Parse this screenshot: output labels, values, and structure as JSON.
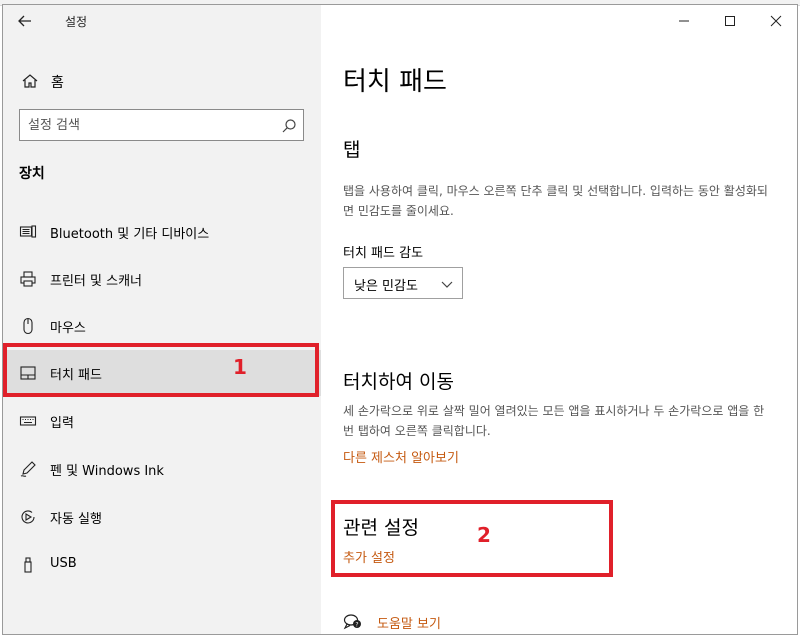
{
  "window": {
    "title": "설정",
    "back_icon": "back-arrow-icon",
    "controls": {
      "minimize_icon": "minimize-icon",
      "maximize_icon": "maximize-icon",
      "close_icon": "close-icon"
    }
  },
  "sidebar": {
    "home_label": "홈",
    "search_placeholder": "설정 검색",
    "section_title": "장치",
    "items": [
      {
        "label": "Bluetooth 및 기타 디바이스",
        "icon": "bluetooth-devices-icon"
      },
      {
        "label": "프린터 및 스캐너",
        "icon": "printer-icon"
      },
      {
        "label": "마우스",
        "icon": "mouse-icon"
      },
      {
        "label": "터치 패드",
        "icon": "touchpad-icon",
        "selected": true
      },
      {
        "label": "입력",
        "icon": "keyboard-icon"
      },
      {
        "label": "펜 및 Windows Ink",
        "icon": "pen-icon"
      },
      {
        "label": "자동 실행",
        "icon": "autoplay-icon"
      },
      {
        "label": "USB",
        "icon": "usb-icon"
      }
    ],
    "annotation": "1"
  },
  "main": {
    "page_title": "터치 패드",
    "tap": {
      "heading": "탭",
      "description": "탭을 사용하여 클릭, 마우스 오른쪽 단추 클릭 및 선택합니다. 입력하는 동안 활성화되면 민감도를 줄이세요.",
      "sensitivity_label": "터치 패드 감도",
      "sensitivity_value": "낮은 민감도"
    },
    "scroll": {
      "heading": "터치하여 이동",
      "description": "세 손가락으로 위로 살짝 밀어 열려있는 모든 앱을 표시하거나 두 손가락으로 앱을 한 번 탭하여 오른쪽 클릭합니다.",
      "link": "다른 제스처 알아보기"
    },
    "related": {
      "heading": "관련 설정",
      "link": "추가 설정",
      "annotation": "2"
    },
    "help_link": "도움말 보기"
  },
  "colors": {
    "accent": "#e8702a",
    "link": "#c55a11",
    "annotation": "#e0202a"
  }
}
